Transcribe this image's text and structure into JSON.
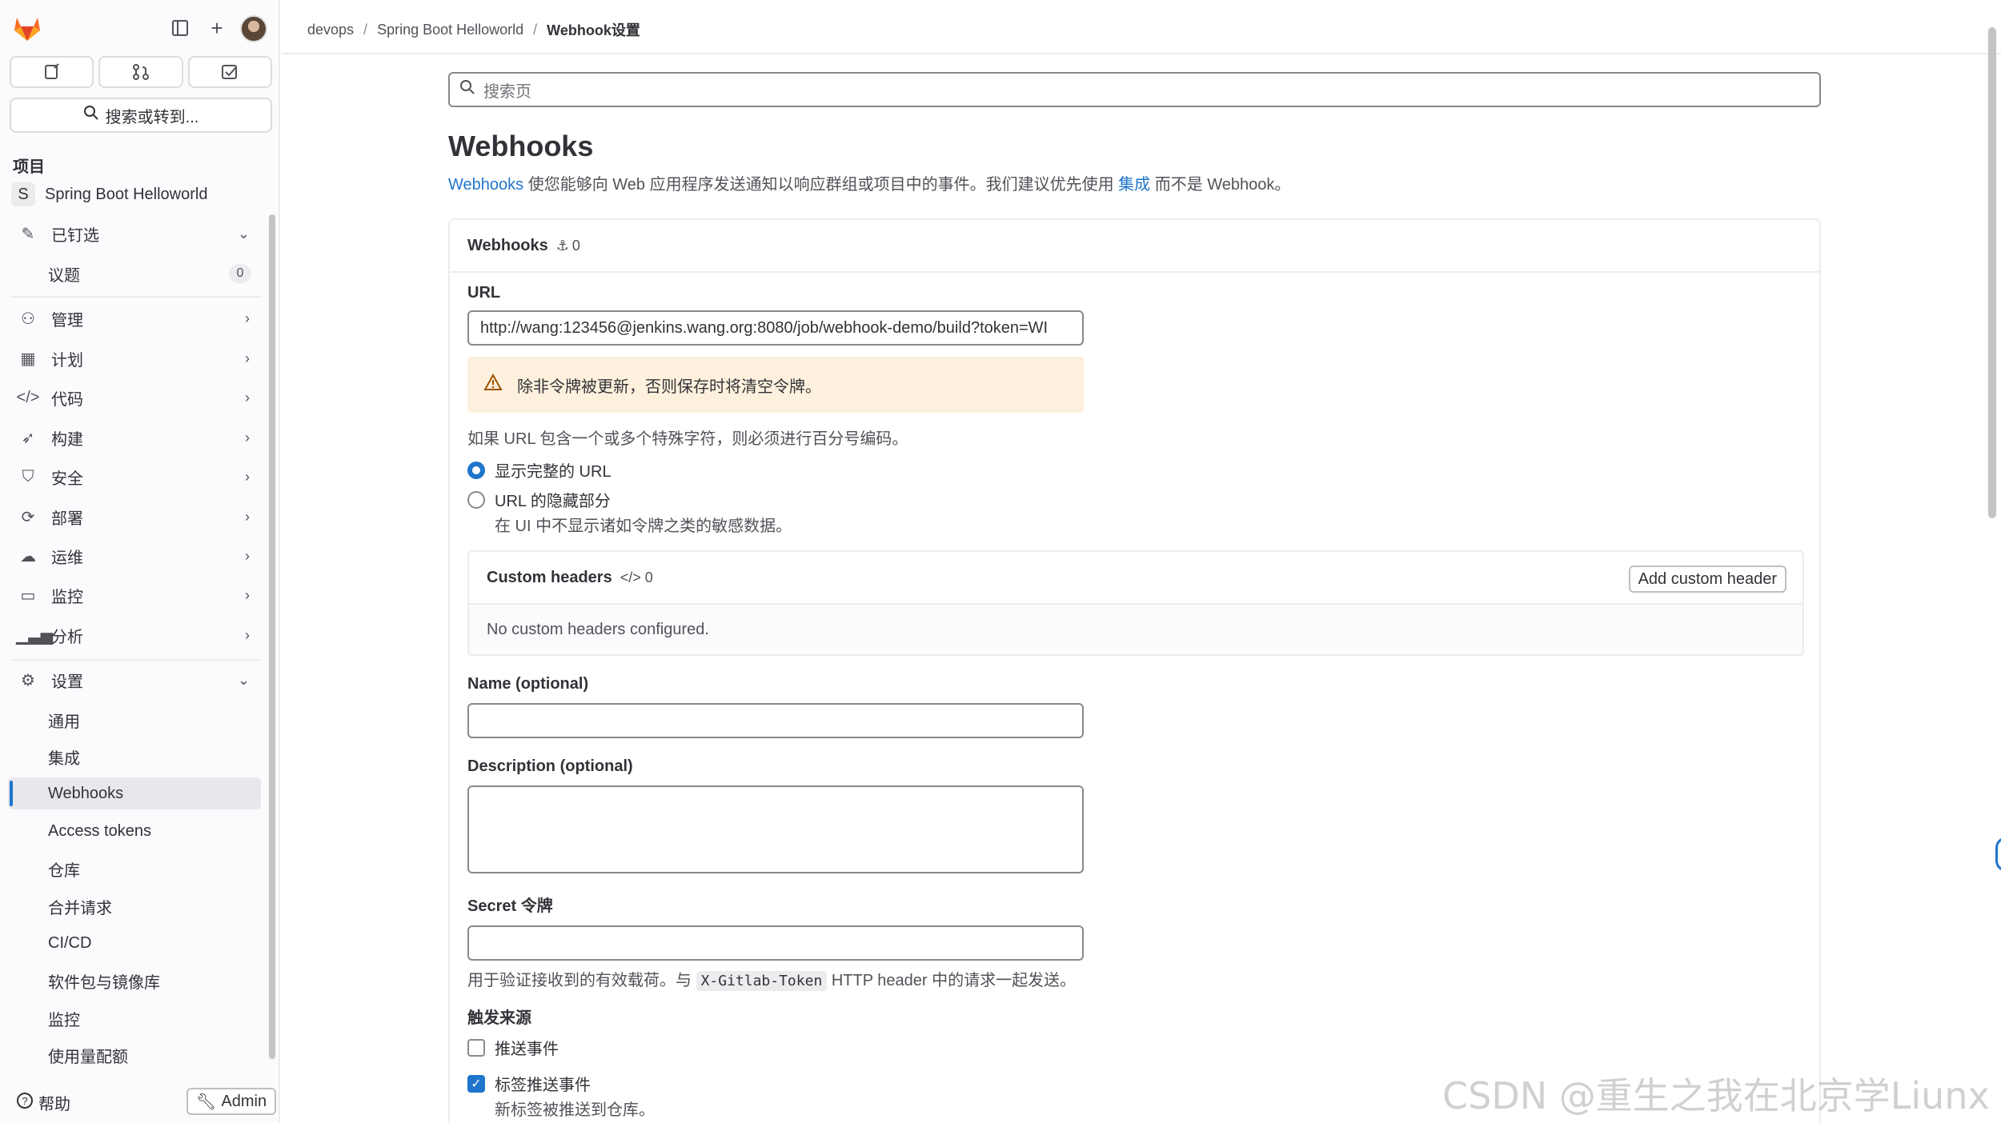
{
  "sidebar": {
    "quick_icons": [
      "issues-icon",
      "merge-request-icon",
      "todo-icon"
    ],
    "search_label": "搜索或转到...",
    "section_title": "项目",
    "project_badge": "S",
    "project_name": "Spring Boot Helloworld",
    "pinned": "已钉选",
    "pinned_items": [
      {
        "label": "议题",
        "count": "0"
      }
    ],
    "groups": [
      {
        "label": "管理",
        "icon": "users-icon"
      },
      {
        "label": "计划",
        "icon": "calendar-icon"
      },
      {
        "label": "代码",
        "icon": "code-icon"
      },
      {
        "label": "构建",
        "icon": "rocket-icon"
      },
      {
        "label": "安全",
        "icon": "shield-icon"
      },
      {
        "label": "部署",
        "icon": "deploy-icon"
      },
      {
        "label": "运维",
        "icon": "cloud-icon"
      },
      {
        "label": "监控",
        "icon": "monitor-icon"
      },
      {
        "label": "分析",
        "icon": "chart-icon"
      }
    ],
    "settings": "设置",
    "settings_items": [
      "通用",
      "集成",
      "Webhooks",
      "Access tokens",
      "仓库",
      "合并请求",
      "CI/CD",
      "软件包与镜像库",
      "监控",
      "使用量配额"
    ],
    "help": "帮助",
    "admin": "Admin"
  },
  "breadcrumb": [
    "devops",
    "Spring Boot Helloworld",
    "Webhook设置"
  ],
  "page": {
    "search_placeholder": "搜索页",
    "title": "Webhooks",
    "lead_link1": "Webhooks",
    "lead_mid": " 使您能够向 Web 应用程序发送通知以响应群组或项目中的事件。我们建议优先使用 ",
    "lead_link2": "集成",
    "lead_end": " 而不是 Webhook。"
  },
  "card": {
    "title": "Webhooks",
    "count": "0",
    "url_label": "URL",
    "url_value": "http://wang:123456@jenkins.wang.org:8080/job/webhook-demo/build?token=WI",
    "alert": "除非令牌被更新，否则保存时将清空令牌。",
    "url_help": "如果 URL 包含一个或多个特殊字符，则必须进行百分号编码。",
    "radio_full": "显示完整的 URL",
    "radio_masked": "URL 的隐藏部分",
    "radio_masked_help": "在 UI 中不显示诸如令牌之类的敏感数据。",
    "headers_title": "Custom headers",
    "headers_count": "0",
    "headers_add": "Add custom header",
    "headers_empty": "No custom headers configured.",
    "name_label": "Name (optional)",
    "desc_label": "Description (optional)",
    "secret_label": "Secret 令牌",
    "secret_help_a": "用于验证接收到的有效载荷。与 ",
    "secret_help_code": "X-Gitlab-Token",
    "secret_help_b": " HTTP header 中的请求一起发送。",
    "trigger_label": "触发来源",
    "trigger_push": "推送事件",
    "trigger_tag": "标签推送事件",
    "trigger_tag_help": "新标签被推送到仓库。"
  },
  "watermark": "CSDN @重生之我在北京学Liunx"
}
